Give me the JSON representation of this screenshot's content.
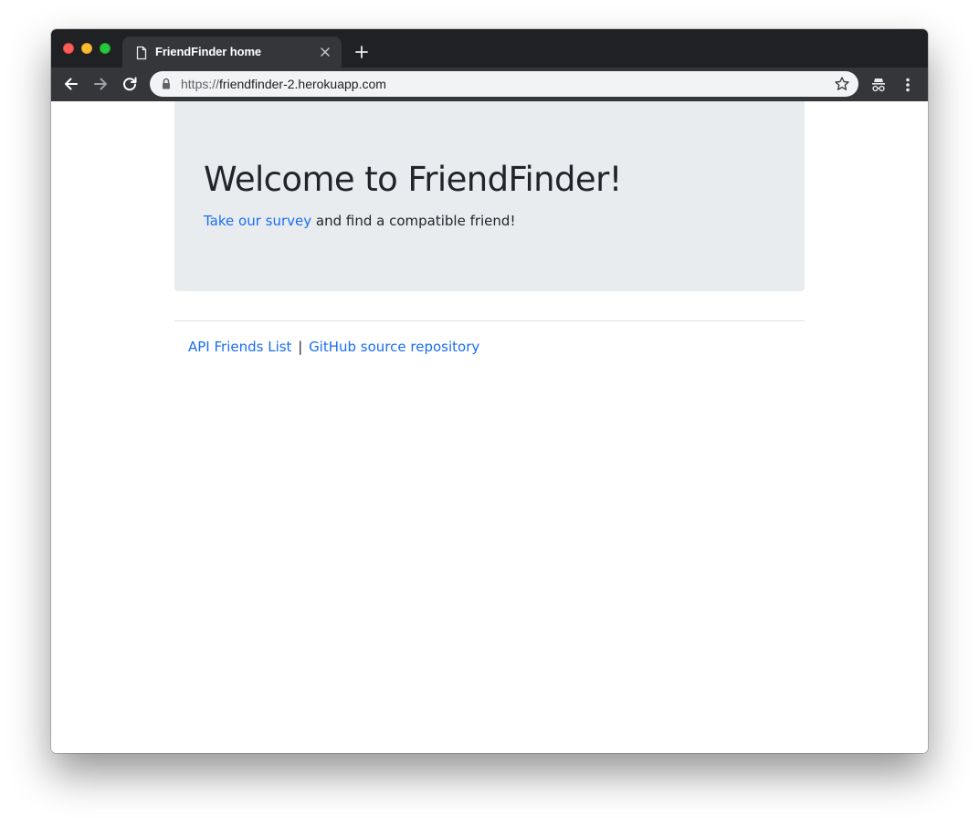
{
  "browser": {
    "tab": {
      "title": "FriendFinder home",
      "icon": "document-icon"
    },
    "address_bar": {
      "scheme": "https://",
      "host": "friendfinder-2.herokuapp.com",
      "secure": true
    },
    "toolbar_icons": [
      "back-arrow-icon",
      "forward-arrow-icon",
      "reload-icon",
      "lock-icon",
      "star-icon",
      "incognito-icon",
      "more-vertical-icon"
    ],
    "colors": {
      "tabstrip": "#202124",
      "toolbar": "#35363a",
      "omnibox": "#f1f3f4"
    }
  },
  "page": {
    "jumbotron": {
      "heading": "Welcome to FriendFinder!",
      "lead_link": "Take our survey",
      "lead_text": " and find a compatible friend!"
    },
    "footer": {
      "api_link": "API Friends List",
      "separator": "|",
      "github_link": "GitHub source repository"
    },
    "colors": {
      "jumbotron_bg": "#e9ecef",
      "link": "#1a6ef2",
      "text": "#212529"
    }
  }
}
